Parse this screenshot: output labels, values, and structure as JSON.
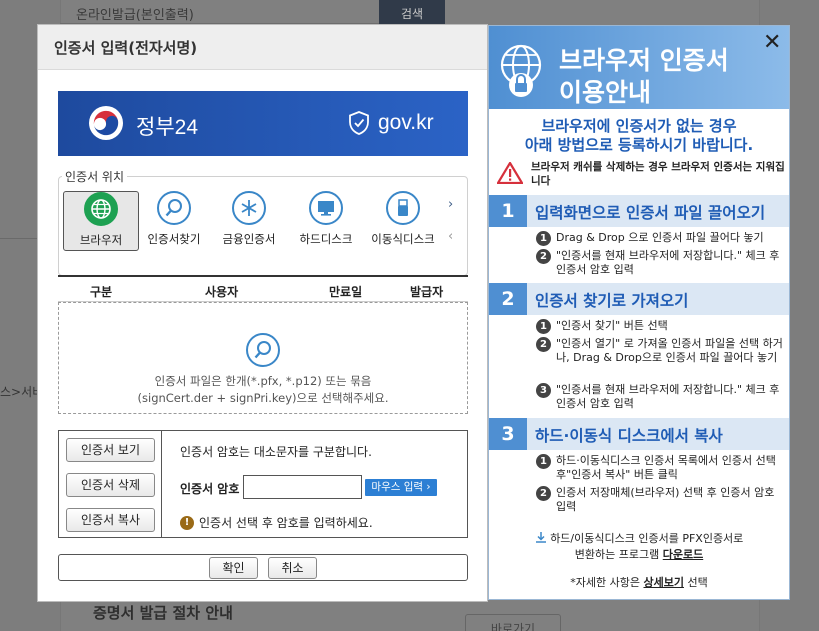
{
  "background": {
    "row_text": "온라인발급(본인출력)",
    "search_button": "검색",
    "side_text": "스>서비",
    "bottom_title": "증명서 발급 절차 안내",
    "bottom_button": "바로가기"
  },
  "modal": {
    "title": "인증서 입력(전자서명)",
    "banner": {
      "name": "정부24",
      "domain": "gov.kr"
    },
    "location": {
      "legend": "인증서 위치",
      "items": [
        {
          "label": "브라우저",
          "icon": "globe-icon",
          "active": true
        },
        {
          "label": "인증서찾기",
          "icon": "search-icon",
          "active": false
        },
        {
          "label": "금융인증서",
          "icon": "asterisk-icon",
          "active": false
        },
        {
          "label": "하드디스크",
          "icon": "monitor-icon",
          "active": false
        },
        {
          "label": "이동식디스크",
          "icon": "usb-icon",
          "active": false
        }
      ],
      "next": "›",
      "prev": "‹"
    },
    "table": {
      "headers": [
        "구분",
        "사용자",
        "만료일",
        "발급자"
      ],
      "drop_line1": "인증서 파일은 한개(*.pfx, *.p12) 또는 묶음",
      "drop_line2": "(signCert.der + signPri.key)으로 선택해주세요."
    },
    "controls": {
      "view_button": "인증서 보기",
      "delete_button": "인증서 삭제",
      "copy_button": "인증서 복사",
      "case_note": "인증서 암호는 대소문자를 구분합니다.",
      "password_label": "인증서 암호",
      "password_value": "",
      "mouse_input_button": "마우스 입력 ›",
      "warning": "인증서 선택 후 암호를 입력하세요."
    },
    "actions": {
      "confirm": "확인",
      "cancel": "취소"
    }
  },
  "guide": {
    "title_line1": "브라우저 인증서",
    "title_line2": "이용안내",
    "close": "✕",
    "intro_line1": "브라우저에 인증서가 없는 경우",
    "intro_line2": "아래 방법으로 등록하시기 바랍니다.",
    "warn": "브라우저 캐쉬를 삭제하는 경우 브라우저 인증서는 지워집니다",
    "steps": [
      {
        "num": "1",
        "title": "입력화면으로 인증서 파일 끌어오기",
        "items": [
          "Drag & Drop 으로 인증서 파일 끌어다 놓기",
          "\"인증서를 현재 브라우저에 저장합니다.\" 체크 후 인증서 암호 입력"
        ]
      },
      {
        "num": "2",
        "title": "인증서 찾기로 가져오기",
        "items": [
          "\"인증서 찾기\" 버튼 선택",
          "\"인증서 열기\" 로 가져올 인증서 파일을 선택 하거나, Drag & Drop으로 인증서 파일 끌어다 놓기",
          "\"인증서를 현재 브라우저에 저장합니다.\" 체크 후 인증서 암호 입력"
        ]
      },
      {
        "num": "3",
        "title": "하드·이동식 디스크에서 복사",
        "items": [
          "하드·이동식디스크 인증서 목록에서 인증서 선택 후\"인증서 복사\" 버튼 클릭",
          "인증서 저장매체(브라우저) 선택 후 인증서 암호 입력"
        ]
      }
    ],
    "pfx_line1": "하드/이동식디스크 인증서를 PFX인증서로",
    "pfx_line2": "변환하는 프로그램",
    "pfx_link": "다운로드",
    "detail_prefix": "*자세한 사항은",
    "detail_link": "상세보기",
    "detail_suffix": "선택"
  }
}
